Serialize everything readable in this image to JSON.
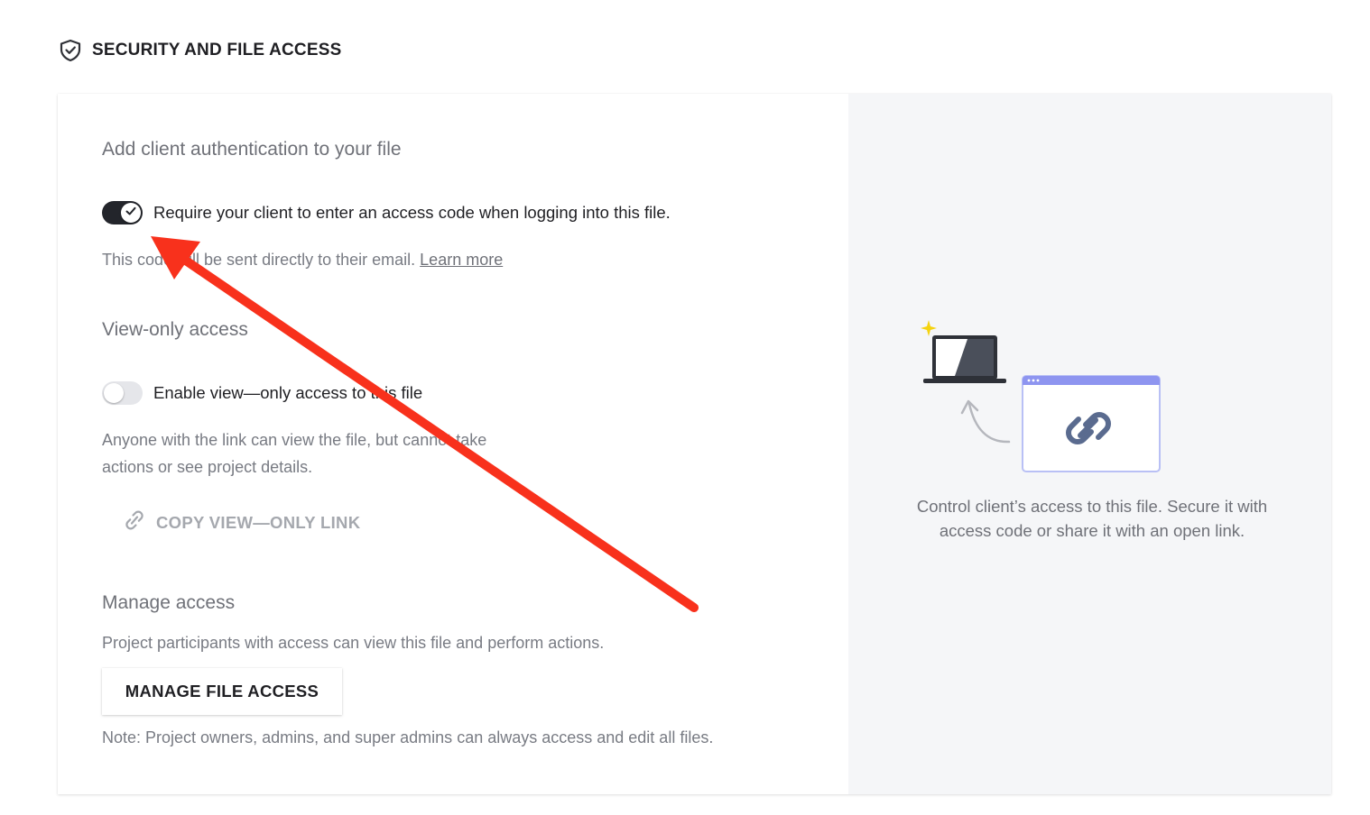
{
  "section": {
    "title": "SECURITY AND FILE ACCESS",
    "icon": "shield-check-icon"
  },
  "auth": {
    "heading": "Add client authentication to your file",
    "toggle_label": "Require your client to enter an access code when logging into this file.",
    "toggle_on": true,
    "description": "This code will be sent directly to their email.",
    "learn_more": "Learn more"
  },
  "view_only": {
    "heading": "View-only access",
    "toggle_label": "Enable view—only access to this file",
    "toggle_on": false,
    "description_line1": "Anyone with the link can view the file, but cannot take",
    "description_line2": "actions or see project details.",
    "copy_link_label": "COPY VIEW—ONLY LINK",
    "copy_link_icon": "link-icon"
  },
  "manage": {
    "heading": "Manage access",
    "description": "Project participants with access can view this file and perform actions.",
    "button_label": "MANAGE FILE ACCESS",
    "note": "Note: Project owners, admins, and super admins can always access and edit all files."
  },
  "side_panel": {
    "caption": "Control client’s access to this file. Secure it with access code or share it with an open link.",
    "illustration": "laptop-and-link-illustration"
  },
  "colors": {
    "toggle_on": "#23252b",
    "toggle_off": "#e5e6ea",
    "side_panel_bg": "#f5f6f8",
    "annotation_arrow": "#f8311c",
    "sparkle": "#f5d30f",
    "browser_bar": "#8e95f0"
  }
}
